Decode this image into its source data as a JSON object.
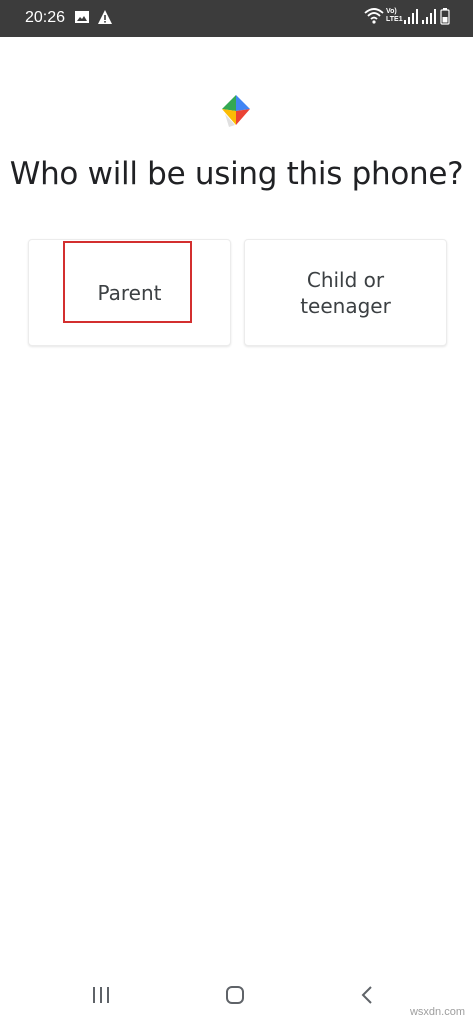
{
  "status_bar": {
    "time": "20:26",
    "left_icons": [
      "image-icon",
      "alert-icon"
    ],
    "right_icons": [
      "wifi-icon",
      "volte-lte-icon",
      "signal-icon",
      "signal-icon",
      "battery-icon"
    ],
    "lte_label": [
      "Vo)",
      "LTE1"
    ]
  },
  "app": {
    "logo_icon": "family-link-logo-icon",
    "title": "Who will be using this phone?",
    "options": [
      {
        "id": "parent",
        "label": "Parent",
        "highlighted": true
      },
      {
        "id": "child",
        "label": "Child or teenager",
        "highlighted": false
      }
    ],
    "highlight_color": "#d32f2f"
  },
  "nav_bar": {
    "buttons": [
      "recents-icon",
      "home-icon",
      "back-icon"
    ]
  },
  "watermark": "wsxdn.com",
  "colors": {
    "status_bar_bg": "#3c3c3c",
    "title_text": "#202124",
    "card_text": "#3c4043",
    "logo_blue": "#4285f4",
    "logo_green": "#34a853",
    "logo_yellow": "#fbbc04",
    "logo_red": "#ea4335"
  }
}
